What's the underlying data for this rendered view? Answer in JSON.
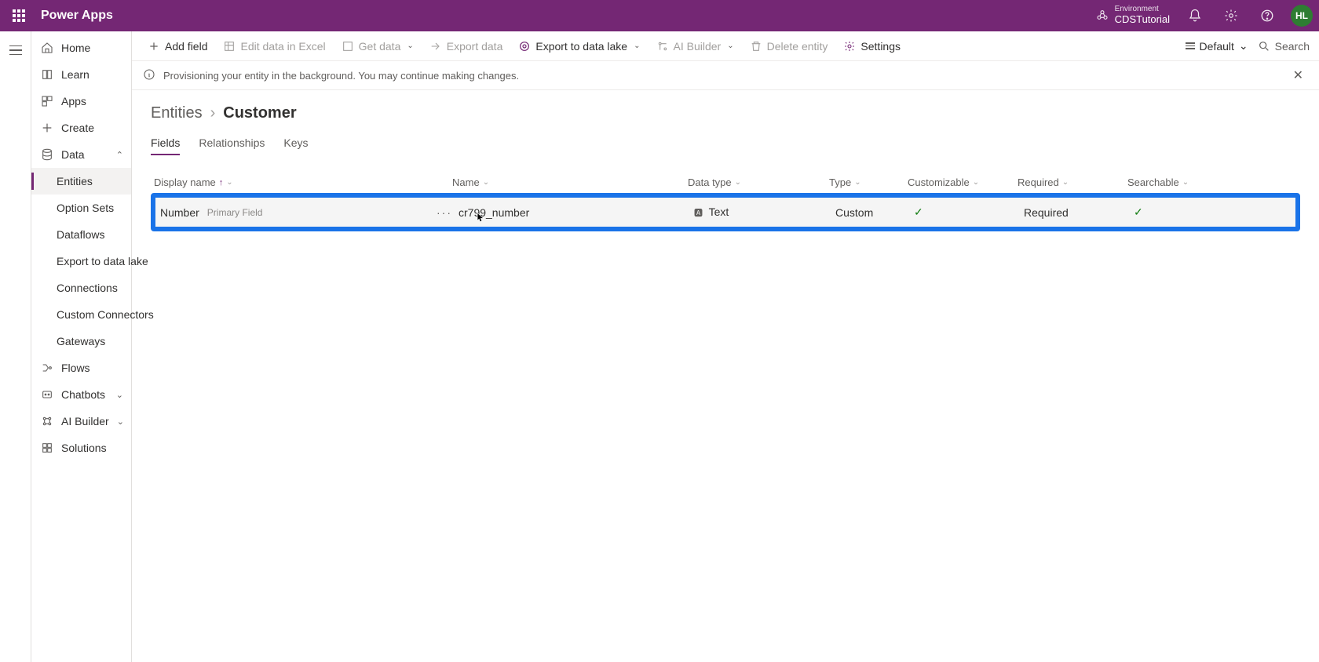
{
  "header": {
    "brand": "Power Apps",
    "env_label": "Environment",
    "env_name": "CDSTutorial",
    "avatar_initials": "HL"
  },
  "sidebar": {
    "items": [
      {
        "label": "Home"
      },
      {
        "label": "Learn"
      },
      {
        "label": "Apps"
      },
      {
        "label": "Create"
      },
      {
        "label": "Data",
        "expandable": true,
        "expanded": true
      },
      {
        "label": "Entities",
        "sub": true,
        "active": true
      },
      {
        "label": "Option Sets",
        "sub": true
      },
      {
        "label": "Dataflows",
        "sub": true
      },
      {
        "label": "Export to data lake",
        "sub": true
      },
      {
        "label": "Connections",
        "sub": true
      },
      {
        "label": "Custom Connectors",
        "sub": true
      },
      {
        "label": "Gateways",
        "sub": true
      },
      {
        "label": "Flows"
      },
      {
        "label": "Chatbots",
        "expandable": true
      },
      {
        "label": "AI Builder",
        "expandable": true
      },
      {
        "label": "Solutions"
      }
    ]
  },
  "commands": {
    "add_field": "Add field",
    "edit_excel": "Edit data in Excel",
    "get_data": "Get data",
    "export_data": "Export data",
    "export_lake": "Export to data lake",
    "ai_builder": "AI Builder",
    "delete_entity": "Delete entity",
    "settings": "Settings",
    "view_label": "Default",
    "search_label": "Search"
  },
  "infobar": {
    "message": "Provisioning your entity in the background. You may continue making changes."
  },
  "breadcrumb": {
    "root": "Entities",
    "leaf": "Customer"
  },
  "tabs": {
    "fields": "Fields",
    "relationships": "Relationships",
    "keys": "Keys"
  },
  "columns": {
    "display_name": "Display name",
    "name": "Name",
    "data_type": "Data type",
    "type": "Type",
    "customizable": "Customizable",
    "required": "Required",
    "searchable": "Searchable"
  },
  "row": {
    "display_name": "Number",
    "primary_tag": "Primary Field",
    "name": "cr799_number",
    "data_type": "Text",
    "type": "Custom",
    "required": "Required"
  }
}
